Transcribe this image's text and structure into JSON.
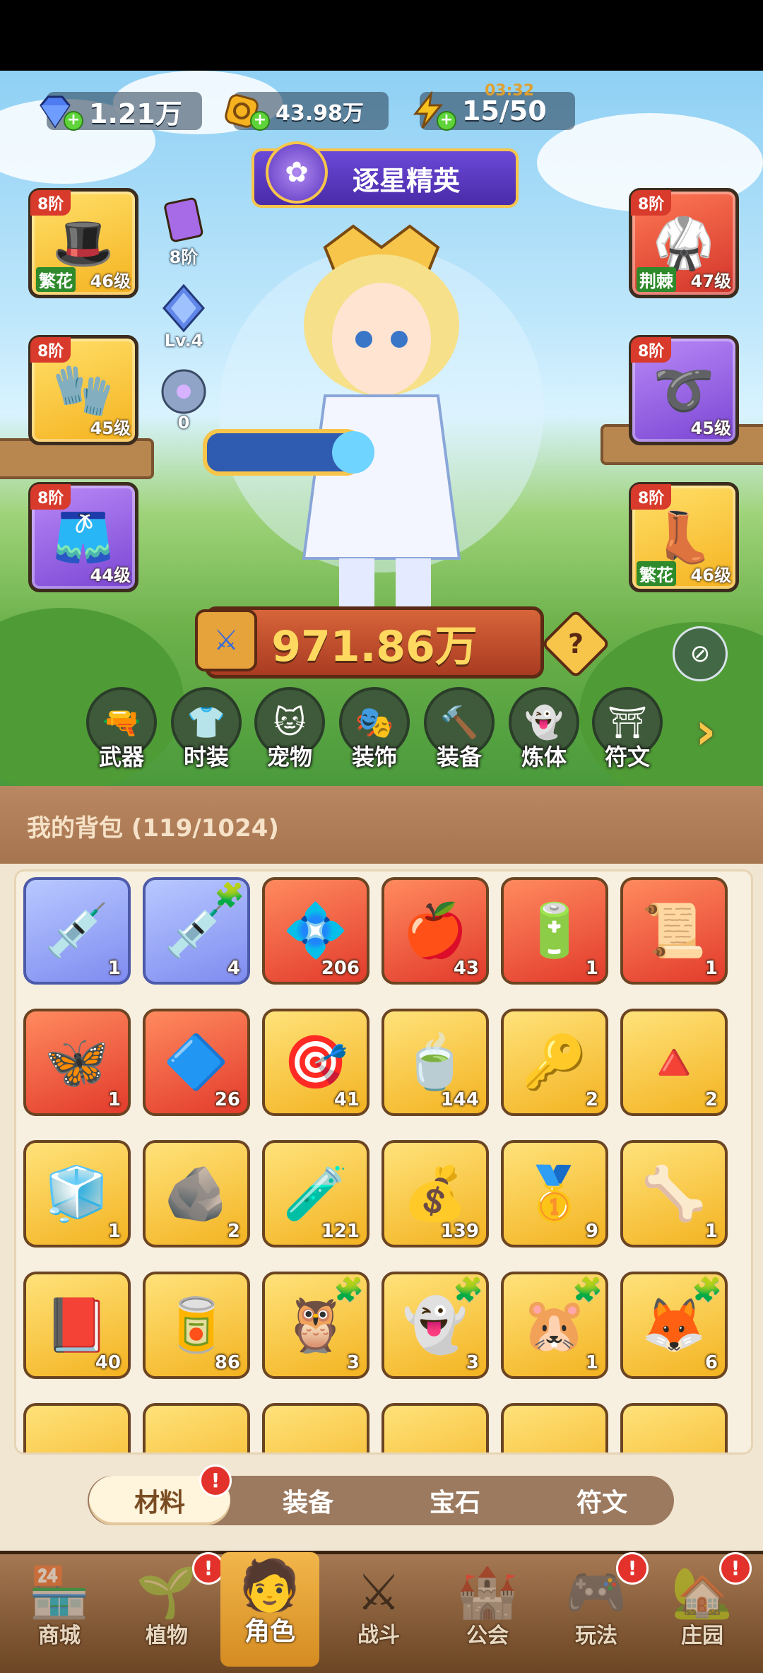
{
  "resources": {
    "gems": "1.21万",
    "coins": "43.98万",
    "energy": "15/50",
    "energy_timer": "03:32"
  },
  "title_banner": "逐星精英",
  "equipment": {
    "hat": {
      "tier": "8阶",
      "tag": "繁花",
      "level": "46级",
      "icon": "hat-icon"
    },
    "gloves": {
      "tier": "8阶",
      "level": "45级",
      "icon": "gloves-icon"
    },
    "pants": {
      "tier": "8阶",
      "level": "44级",
      "icon": "pants-icon"
    },
    "armor": {
      "tier": "8阶",
      "tag": "荆棘",
      "level": "47级",
      "icon": "armor-icon"
    },
    "belt": {
      "tier": "8阶",
      "level": "45级",
      "icon": "belt-icon"
    },
    "boots": {
      "tier": "8阶",
      "tag": "繁花",
      "level": "46级",
      "icon": "boots-icon"
    }
  },
  "mini_items": {
    "pet_card": "8阶",
    "crystal": "Lv.4",
    "orb": "0"
  },
  "combat_power": "971.86万",
  "categories": [
    "武器",
    "时装",
    "宠物",
    "装饰",
    "装备",
    "炼体",
    "符文"
  ],
  "backpack": {
    "title": "我的背包 (119/1024)",
    "items": [
      {
        "icon": "syringe-icon",
        "count": "1",
        "rarity": "blue"
      },
      {
        "icon": "syringe-icon",
        "count": "4",
        "rarity": "blue",
        "puzzle": true
      },
      {
        "icon": "star-crystal-icon",
        "count": "206",
        "rarity": "red"
      },
      {
        "icon": "potion-icon",
        "count": "43",
        "rarity": "red"
      },
      {
        "icon": "battery-icon",
        "count": "1",
        "rarity": "red"
      },
      {
        "icon": "scroll-icon",
        "count": "1",
        "rarity": "red"
      },
      {
        "icon": "butterfly-icon",
        "count": "1",
        "rarity": "red"
      },
      {
        "icon": "prism-icon",
        "count": "26",
        "rarity": "red"
      },
      {
        "icon": "dart-icon",
        "count": "41",
        "rarity": "gold"
      },
      {
        "icon": "teacup-icon",
        "count": "144",
        "rarity": "gold"
      },
      {
        "icon": "key-icon",
        "count": "2",
        "rarity": "gold"
      },
      {
        "icon": "pyramid-icon",
        "count": "2",
        "rarity": "gold"
      },
      {
        "icon": "cube-icon",
        "count": "1",
        "rarity": "gold"
      },
      {
        "icon": "rune-stone-icon",
        "count": "2",
        "rarity": "gold"
      },
      {
        "icon": "orange-potion-icon",
        "count": "121",
        "rarity": "gold"
      },
      {
        "icon": "gold-pile-icon",
        "count": "139",
        "rarity": "gold"
      },
      {
        "icon": "gold-ore-icon",
        "count": "9",
        "rarity": "gold"
      },
      {
        "icon": "bone-icon",
        "count": "1",
        "rarity": "gold"
      },
      {
        "icon": "book-icon",
        "count": "40",
        "rarity": "gold"
      },
      {
        "icon": "can-food-icon",
        "count": "86",
        "rarity": "gold"
      },
      {
        "icon": "owl-pet-icon",
        "count": "3",
        "rarity": "gold",
        "puzzle": true
      },
      {
        "icon": "ghost-pet-icon",
        "count": "3",
        "rarity": "gold",
        "puzzle": true
      },
      {
        "icon": "capybara-pet-icon",
        "count": "1",
        "rarity": "gold",
        "puzzle": true
      },
      {
        "icon": "fox-pet-icon",
        "count": "6",
        "rarity": "gold",
        "puzzle": true
      }
    ]
  },
  "tabs": [
    "材料",
    "装备",
    "宝石",
    "符文"
  ],
  "tab_badge": "!",
  "nav": [
    {
      "label": "商城",
      "icon": "shop-icon"
    },
    {
      "label": "植物",
      "icon": "plant-icon",
      "badge": "!"
    },
    {
      "label": "角色",
      "icon": "character-icon",
      "active": true
    },
    {
      "label": "战斗",
      "icon": "battle-icon"
    },
    {
      "label": "公会",
      "icon": "guild-icon"
    },
    {
      "label": "玩法",
      "icon": "gameplay-icon",
      "badge": "!"
    },
    {
      "label": "庄园",
      "icon": "manor-icon",
      "badge": "!"
    }
  ]
}
